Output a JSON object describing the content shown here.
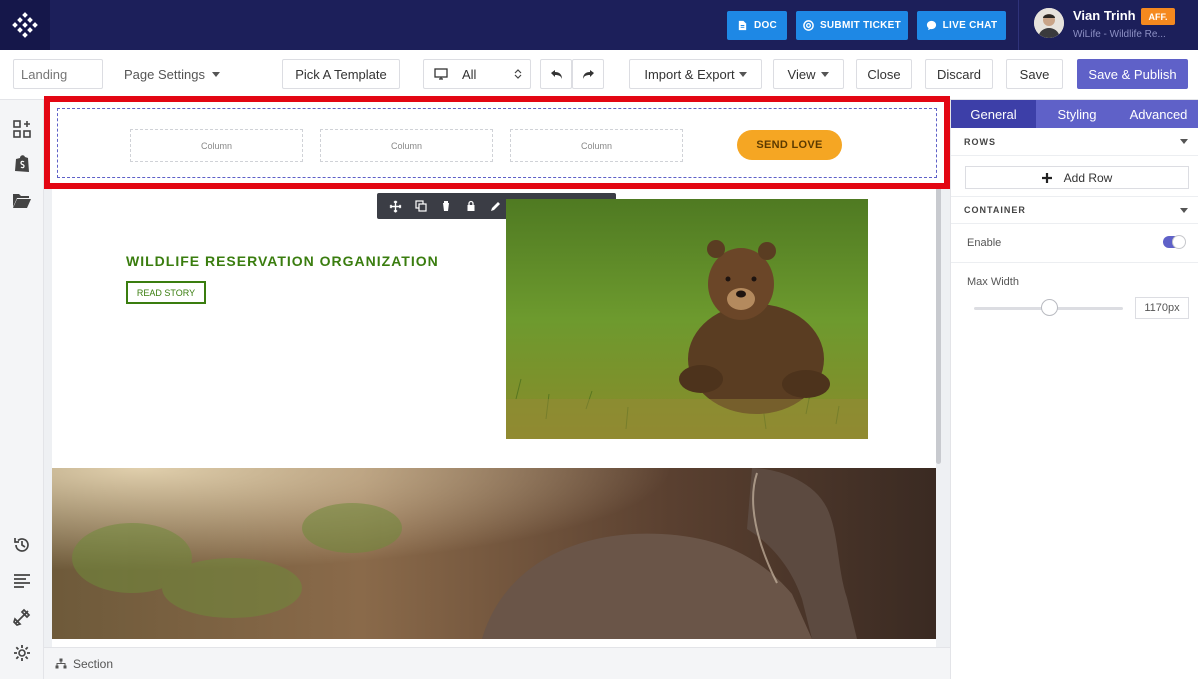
{
  "topbar": {
    "doc_label": "DOC",
    "ticket_label": "SUBMIT TICKET",
    "chat_label": "LIVE CHAT",
    "user_name": "Vian Trinh",
    "user_badge": "AFF.",
    "user_subtitle": "WiLife - Wildlife Re...",
    "button_color": "#1e88e5",
    "bar_color": "#1c1f5a"
  },
  "toolbar": {
    "page_name_placeholder": "Landing",
    "page_settings_label": "Page Settings",
    "pick_template_label": "Pick A Template",
    "device_label": "All",
    "import_export_label": "Import & Export",
    "view_label": "View",
    "close_label": "Close",
    "discard_label": "Discard",
    "save_label": "Save",
    "save_publish_label": "Save & Publish",
    "accent_color": "#5f61c8"
  },
  "sidebar_icons": [
    "add-element-icon",
    "shopify-icon",
    "folder-icon",
    "history-icon",
    "outline-icon",
    "tools-icon",
    "gear-icon"
  ],
  "canvas": {
    "header_columns": [
      "Column",
      "Column",
      "Column"
    ],
    "send_love_label": "SEND LOVE",
    "org_title": "WILDLIFE RESERVATION ORGANIZATION",
    "read_story_label": "READ STORY",
    "highlight_color": "#e30613"
  },
  "row_toolbar_icons": [
    "move-icon",
    "duplicate-icon",
    "delete-icon",
    "lock-icon",
    "edit-icon",
    "save-icon",
    "copy-icon",
    "paste-icon",
    "download-icon"
  ],
  "statusbar": {
    "breadcrumb": "Section"
  },
  "panel": {
    "tabs": [
      "General",
      "Styling",
      "Advanced"
    ],
    "active_tab": "General",
    "rows_heading": "ROWS",
    "add_row_label": "Add Row",
    "container_heading": "CONTAINER",
    "enable_label": "Enable",
    "enable_on": true,
    "max_width_label": "Max Width",
    "max_width_value": "1170px",
    "max_width_slider_fraction": 0.51
  }
}
